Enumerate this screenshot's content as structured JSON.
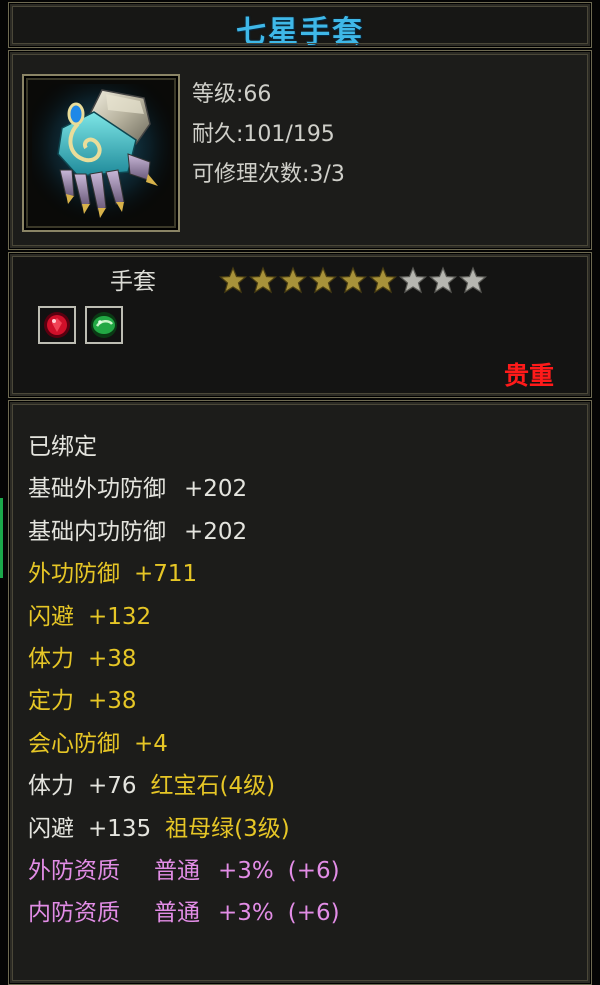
{
  "title": "七星手套",
  "item": {
    "icon": "gauntlet-icon",
    "level_label": "等级:66",
    "durability_label": "耐久:101/195",
    "repair_label": "可修理次数:3/3"
  },
  "type_label": "手套",
  "stars": {
    "filled": 6,
    "total": 9,
    "filled_color": "#a8923a",
    "empty_color": "#b6b6b0"
  },
  "gems": [
    {
      "name": "ruby-gem-icon",
      "color": "#d0102a"
    },
    {
      "name": "emerald-gem-icon",
      "color": "#22a844"
    }
  ],
  "rarity_label": "贵重",
  "attributes": {
    "bound": "已绑定",
    "base_ext_def_name": "基础外功防御",
    "base_ext_def_value": "+202",
    "base_int_def_name": "基础内功防御",
    "base_int_def_value": "+202",
    "ext_def_name": "外功防御",
    "ext_def_value": "+711",
    "dodge_name": "闪避",
    "dodge_value": "+132",
    "stamina_name": "体力",
    "stamina_value": "+38",
    "focus_name": "定力",
    "focus_value": "+38",
    "crit_def_name": "会心防御",
    "crit_def_value": "+4",
    "gem1_stat": "体力",
    "gem1_value": "+76",
    "gem1_name": "红宝石(4级)",
    "gem2_stat": "闪避",
    "gem2_value": "+135",
    "gem2_name": "祖母绿(3级)",
    "q1_name": "外防资质",
    "q1_grade": "普通",
    "q1_pct": "+3%",
    "q1_bonus": "(+6)",
    "q2_name": "内防资质",
    "q2_grade": "普通",
    "q2_pct": "+3%",
    "q2_bonus": "(+6)"
  },
  "colors": {
    "title": "#3fb8e8",
    "rarity": "#ff1a1a",
    "gold": "#e6c626",
    "pink": "#e28de6"
  }
}
